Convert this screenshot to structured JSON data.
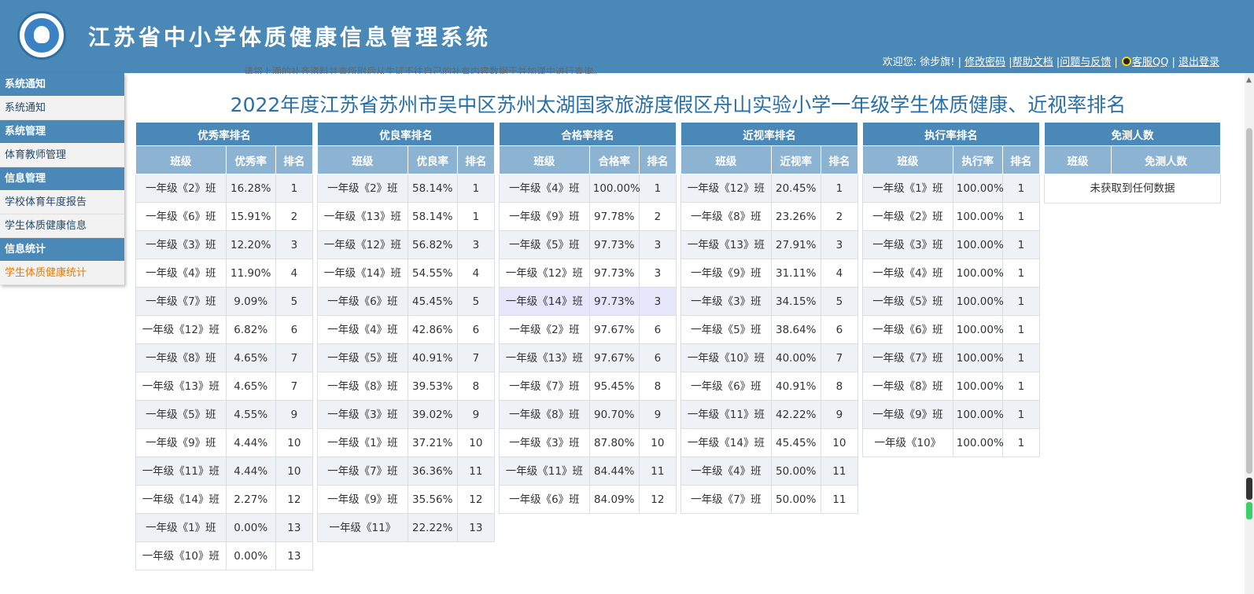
{
  "header": {
    "title": "江苏省中小学体质健康信息管理系统",
    "welcome": "欢迎您: 徐步旗! |",
    "links": [
      "修改密码",
      "帮助文档",
      "问题与反馈",
      "客服QQ",
      "退出登录"
    ]
  },
  "sidebar": {
    "groups": [
      {
        "label": "系统通知",
        "items": [
          "系统通知"
        ]
      },
      {
        "label": "系统管理",
        "items": [
          "体育教师管理"
        ]
      },
      {
        "label": "信息管理",
        "items": [
          "学校体育年度报告",
          "学生体质健康信息"
        ]
      },
      {
        "label": "信息统计",
        "items": [
          "学生体质健康统计"
        ]
      }
    ],
    "active_item": "学生体质健康统计"
  },
  "notice_partial": "请将上面的补齐资料并查所附后从生证不往自己的补有内容数据于并加课中进行查询。",
  "page_title": "2022年度江苏省苏州市吴中区苏州太湖国家旅游度假区舟山实验小学一年级学生体质健康、近视率排名",
  "tables": {
    "excellent": {
      "caption": "优秀率排名",
      "headers": [
        "班级",
        "优秀率",
        "排名"
      ],
      "rows": [
        [
          "一年级《2》班",
          "16.28%",
          "1"
        ],
        [
          "一年级《6》班",
          "15.91%",
          "2"
        ],
        [
          "一年级《3》班",
          "12.20%",
          "3"
        ],
        [
          "一年级《4》班",
          "11.90%",
          "4"
        ],
        [
          "一年级《7》班",
          "9.09%",
          "5"
        ],
        [
          "一年级《12》班",
          "6.82%",
          "6"
        ],
        [
          "一年级《8》班",
          "4.65%",
          "7"
        ],
        [
          "一年级《13》班",
          "4.65%",
          "7"
        ],
        [
          "一年级《5》班",
          "4.55%",
          "9"
        ],
        [
          "一年级《9》班",
          "4.44%",
          "10"
        ],
        [
          "一年级《11》班",
          "4.44%",
          "10"
        ],
        [
          "一年级《14》班",
          "2.27%",
          "12"
        ],
        [
          "一年级《1》班",
          "0.00%",
          "13"
        ],
        [
          "一年级《10》班",
          "0.00%",
          "13"
        ]
      ]
    },
    "good": {
      "caption": "优良率排名",
      "headers": [
        "班级",
        "优良率",
        "排名"
      ],
      "rows": [
        [
          "一年级《2》班",
          "58.14%",
          "1"
        ],
        [
          "一年级《13》班",
          "58.14%",
          "1"
        ],
        [
          "一年级《12》班",
          "56.82%",
          "3"
        ],
        [
          "一年级《14》班",
          "54.55%",
          "4"
        ],
        [
          "一年级《6》班",
          "45.45%",
          "5"
        ],
        [
          "一年级《4》班",
          "42.86%",
          "6"
        ],
        [
          "一年级《5》班",
          "40.91%",
          "7"
        ],
        [
          "一年级《8》班",
          "39.53%",
          "8"
        ],
        [
          "一年级《3》班",
          "39.02%",
          "9"
        ],
        [
          "一年级《1》班",
          "37.21%",
          "10"
        ],
        [
          "一年级《7》班",
          "36.36%",
          "11"
        ],
        [
          "一年级《9》班",
          "35.56%",
          "12"
        ],
        [
          "一年级《11》",
          "22.22%",
          "13"
        ]
      ]
    },
    "pass": {
      "caption": "合格率排名",
      "headers": [
        "班级",
        "合格率",
        "排名"
      ],
      "rows": [
        [
          "一年级《4》班",
          "100.00%",
          "1"
        ],
        [
          "一年级《9》班",
          "97.78%",
          "2"
        ],
        [
          "一年级《5》班",
          "97.73%",
          "3"
        ],
        [
          "一年级《12》班",
          "97.73%",
          "3"
        ],
        [
          "一年级《14》班",
          "97.73%",
          "3"
        ],
        [
          "一年级《2》班",
          "97.67%",
          "6"
        ],
        [
          "一年级《13》班",
          "97.67%",
          "6"
        ],
        [
          "一年级《7》班",
          "95.45%",
          "8"
        ],
        [
          "一年级《8》班",
          "90.70%",
          "9"
        ],
        [
          "一年级《3》班",
          "87.80%",
          "10"
        ],
        [
          "一年级《11》班",
          "84.44%",
          "11"
        ],
        [
          "一年级《6》班",
          "84.09%",
          "12"
        ]
      ],
      "highlighted_row": 4
    },
    "myopia": {
      "caption": "近视率排名",
      "headers": [
        "班级",
        "近视率",
        "排名"
      ],
      "rows": [
        [
          "一年级《12》班",
          "20.45%",
          "1"
        ],
        [
          "一年级《8》班",
          "23.26%",
          "2"
        ],
        [
          "一年级《13》班",
          "27.91%",
          "3"
        ],
        [
          "一年级《9》班",
          "31.11%",
          "4"
        ],
        [
          "一年级《3》班",
          "34.15%",
          "5"
        ],
        [
          "一年级《5》班",
          "38.64%",
          "6"
        ],
        [
          "一年级《10》班",
          "40.00%",
          "7"
        ],
        [
          "一年级《6》班",
          "40.91%",
          "8"
        ],
        [
          "一年级《11》班",
          "42.22%",
          "9"
        ],
        [
          "一年级《14》班",
          "45.45%",
          "10"
        ],
        [
          "一年级《4》班",
          "50.00%",
          "11"
        ],
        [
          "一年级《7》班",
          "50.00%",
          "11"
        ]
      ]
    },
    "execution": {
      "caption": "执行率排名",
      "headers": [
        "班级",
        "执行率",
        "排名"
      ],
      "rows": [
        [
          "一年级《1》班",
          "100.00%",
          "1"
        ],
        [
          "一年级《2》班",
          "100.00%",
          "1"
        ],
        [
          "一年级《3》班",
          "100.00%",
          "1"
        ],
        [
          "一年级《4》班",
          "100.00%",
          "1"
        ],
        [
          "一年级《5》班",
          "100.00%",
          "1"
        ],
        [
          "一年级《6》班",
          "100.00%",
          "1"
        ],
        [
          "一年级《7》班",
          "100.00%",
          "1"
        ],
        [
          "一年级《8》班",
          "100.00%",
          "1"
        ],
        [
          "一年级《9》班",
          "100.00%",
          "1"
        ],
        [
          "一年级《10》",
          "100.00%",
          "1"
        ]
      ]
    },
    "exempt": {
      "caption": "免测人数",
      "headers": [
        "班级",
        "免测人数"
      ],
      "empty_text": "未获取到任何数据"
    }
  }
}
